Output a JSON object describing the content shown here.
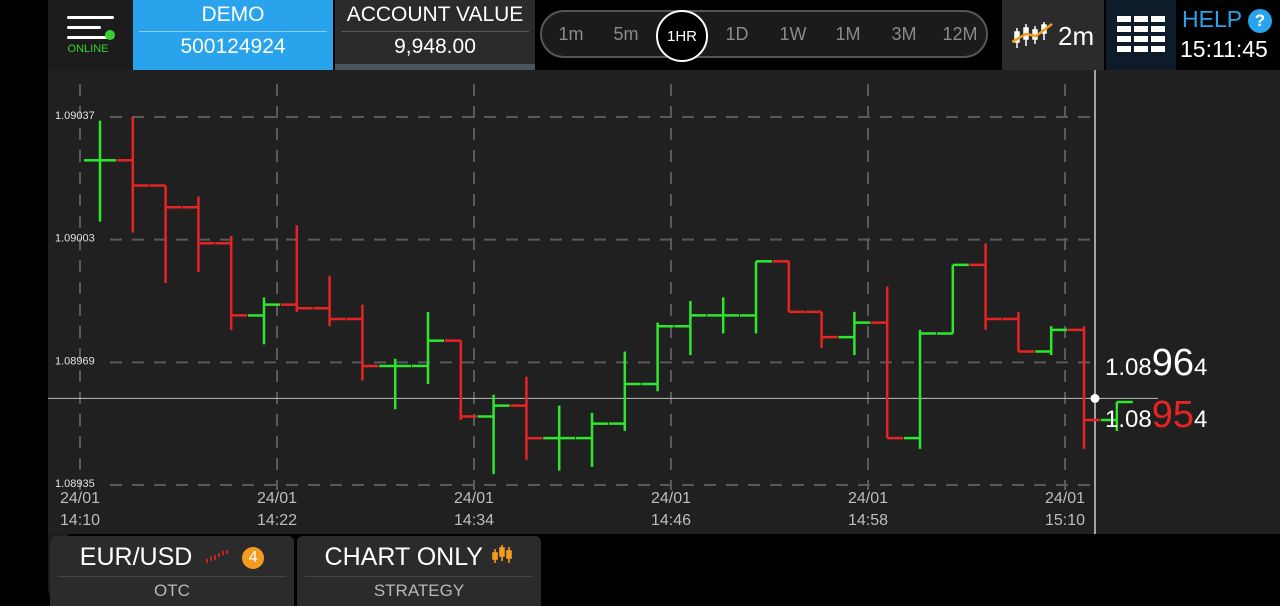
{
  "header": {
    "online_label": "ONLINE",
    "demo_label": "DEMO",
    "demo_account": "500124924",
    "account_value_label": "ACCOUNT VALUE",
    "account_value": "9,948.00",
    "timeframes": [
      "1m",
      "5m",
      "1HR",
      "1D",
      "1W",
      "1M",
      "3M",
      "12M"
    ],
    "active_timeframe": "1HR",
    "candle_interval": "2m",
    "help_label": "HELP",
    "help_icon_text": "?",
    "clock": "15:11:45"
  },
  "prices": {
    "ask_prefix": "1.08",
    "ask_big": "96",
    "ask_suffix": "4",
    "bid_prefix": "1.08",
    "bid_big": "95",
    "bid_suffix": "4"
  },
  "bottom": {
    "asset": "EUR/USD",
    "asset_badge": "4",
    "asset_sub": "OTC",
    "strategy": "CHART ONLY",
    "strategy_sub": "STRATEGY"
  },
  "colors": {
    "up": "#2ee62e",
    "down": "#e62424",
    "accent": "#29a3ec",
    "badge": "#f39c1f"
  },
  "chart_data": {
    "type": "ohlc",
    "ylim": [
      1.08935,
      1.09037
    ],
    "y_ticks": [
      "1.09037",
      "1.09003",
      "1.08969",
      "1.08935"
    ],
    "x_ticks": [
      [
        "24/01",
        "14:10"
      ],
      [
        "24/01",
        "14:22"
      ],
      [
        "24/01",
        "14:34"
      ],
      [
        "24/01",
        "14:46"
      ],
      [
        "24/01",
        "14:58"
      ],
      [
        "24/01",
        "15:10"
      ]
    ],
    "current_price": 1.08959,
    "bars": [
      {
        "o": 1.09025,
        "h": 1.09036,
        "l": 1.09008,
        "c": 1.09025
      },
      {
        "o": 1.09025,
        "h": 1.09037,
        "l": 1.09005,
        "c": 1.09018
      },
      {
        "o": 1.09018,
        "h": 1.09014,
        "l": 1.08991,
        "c": 1.09012
      },
      {
        "o": 1.09012,
        "h": 1.09015,
        "l": 1.08994,
        "c": 1.09002
      },
      {
        "o": 1.09002,
        "h": 1.09004,
        "l": 1.08978,
        "c": 1.08982
      },
      {
        "o": 1.08982,
        "h": 1.08987,
        "l": 1.08974,
        "c": 1.08985
      },
      {
        "o": 1.08985,
        "h": 1.09007,
        "l": 1.08983,
        "c": 1.08984
      },
      {
        "o": 1.08984,
        "h": 1.08993,
        "l": 1.08979,
        "c": 1.08981
      },
      {
        "o": 1.08981,
        "h": 1.08985,
        "l": 1.08964,
        "c": 1.08968
      },
      {
        "o": 1.08968,
        "h": 1.0897,
        "l": 1.08956,
        "c": 1.08968
      },
      {
        "o": 1.08968,
        "h": 1.08983,
        "l": 1.08963,
        "c": 1.08975
      },
      {
        "o": 1.08975,
        "h": 1.08975,
        "l": 1.08953,
        "c": 1.08954
      },
      {
        "o": 1.08954,
        "h": 1.0896,
        "l": 1.08938,
        "c": 1.08957
      },
      {
        "o": 1.08957,
        "h": 1.08965,
        "l": 1.08942,
        "c": 1.08948
      },
      {
        "o": 1.08948,
        "h": 1.08957,
        "l": 1.08939,
        "c": 1.08948
      },
      {
        "o": 1.08948,
        "h": 1.08955,
        "l": 1.0894,
        "c": 1.08952
      },
      {
        "o": 1.08952,
        "h": 1.08972,
        "l": 1.0895,
        "c": 1.08963
      },
      {
        "o": 1.08963,
        "h": 1.0898,
        "l": 1.08961,
        "c": 1.08979
      },
      {
        "o": 1.08979,
        "h": 1.08986,
        "l": 1.08971,
        "c": 1.08982
      },
      {
        "o": 1.08982,
        "h": 1.08987,
        "l": 1.08977,
        "c": 1.08982
      },
      {
        "o": 1.08982,
        "h": 1.08997,
        "l": 1.08977,
        "c": 1.08997
      },
      {
        "o": 1.08997,
        "h": 1.08997,
        "l": 1.08983,
        "c": 1.08983
      },
      {
        "o": 1.08983,
        "h": 1.08983,
        "l": 1.08973,
        "c": 1.08976
      },
      {
        "o": 1.08976,
        "h": 1.08983,
        "l": 1.08971,
        "c": 1.0898
      },
      {
        "o": 1.0898,
        "h": 1.0899,
        "l": 1.08955,
        "c": 1.08948
      },
      {
        "o": 1.08948,
        "h": 1.08978,
        "l": 1.08945,
        "c": 1.08977
      },
      {
        "o": 1.08977,
        "h": 1.08996,
        "l": 1.08977,
        "c": 1.08996
      },
      {
        "o": 1.08996,
        "h": 1.09002,
        "l": 1.08978,
        "c": 1.08981
      },
      {
        "o": 1.08981,
        "h": 1.08983,
        "l": 1.08972,
        "c": 1.08972
      },
      {
        "o": 1.08972,
        "h": 1.08979,
        "l": 1.08971,
        "c": 1.08978
      },
      {
        "o": 1.08978,
        "h": 1.08979,
        "l": 1.08945,
        "c": 1.08953
      },
      {
        "o": 1.08953,
        "h": 1.08958,
        "l": 1.0895,
        "c": 1.08958
      }
    ]
  }
}
